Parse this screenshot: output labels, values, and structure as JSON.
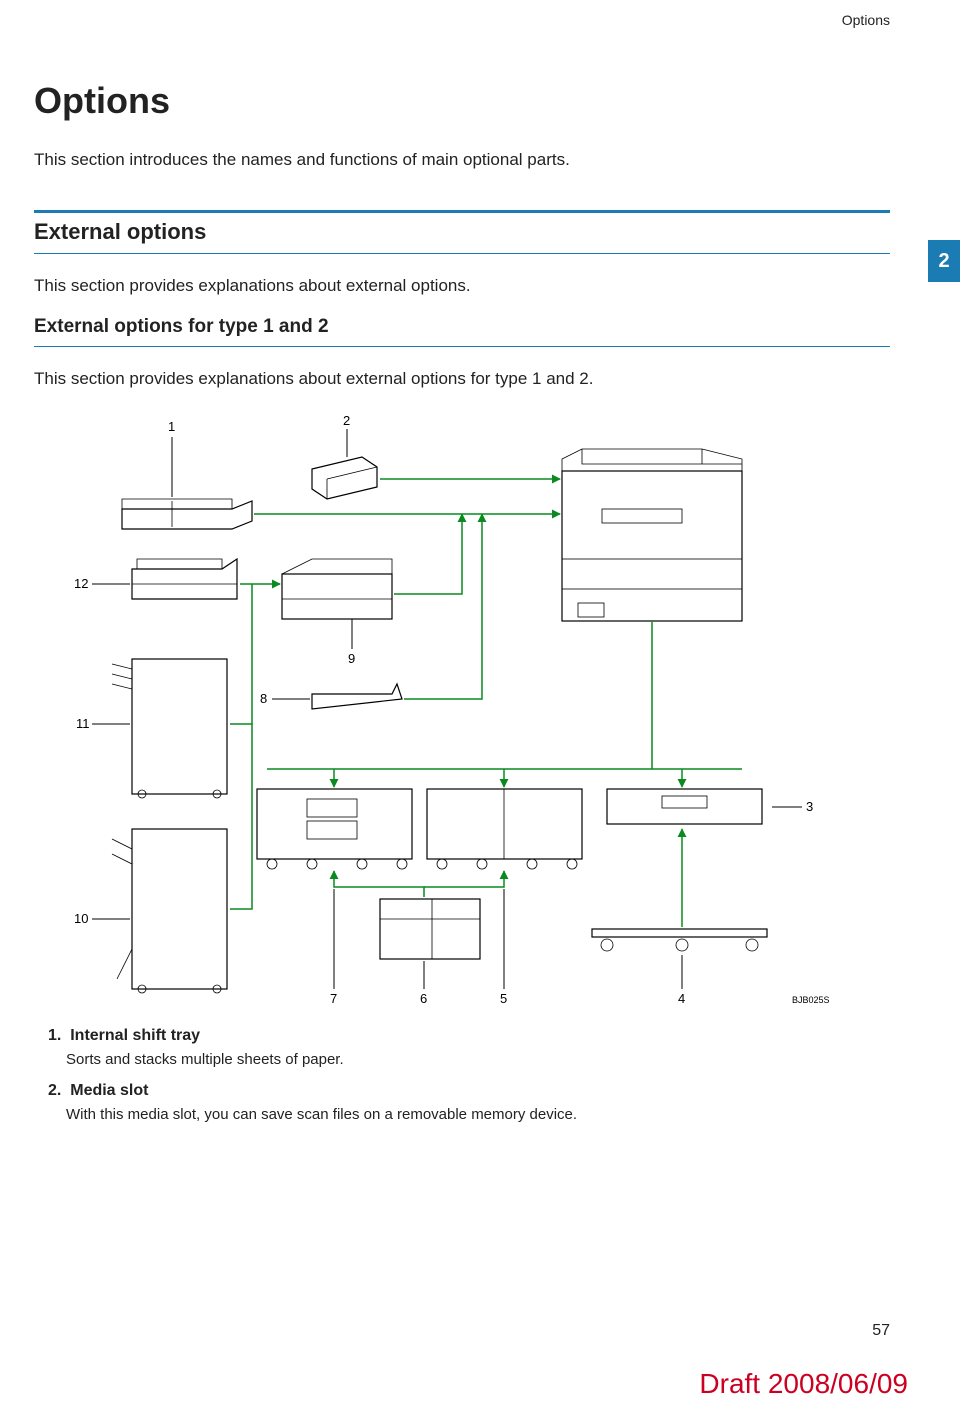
{
  "header": {
    "running_title": "Options"
  },
  "chapter_tab": "2",
  "title": "Options",
  "intro": "This section introduces the names and functions of main optional parts.",
  "section": {
    "heading": "External options",
    "body": "This section provides explanations about external options."
  },
  "subsection": {
    "heading": "External options for type 1 and 2",
    "body": "This section provides explanations about external options for type 1 and 2."
  },
  "figure": {
    "callouts": [
      "1",
      "2",
      "3",
      "4",
      "5",
      "6",
      "7",
      "8",
      "9",
      "10",
      "11",
      "12"
    ],
    "tag": "BJB025S"
  },
  "items": [
    {
      "num": "1.",
      "term": "Internal shift tray",
      "desc": "Sorts and stacks multiple sheets of paper."
    },
    {
      "num": "2.",
      "term": "Media slot",
      "desc": "With this media slot, you can save scan files on a removable memory device."
    }
  ],
  "page_number": "57",
  "draft_stamp": "Draft 2008/06/09"
}
